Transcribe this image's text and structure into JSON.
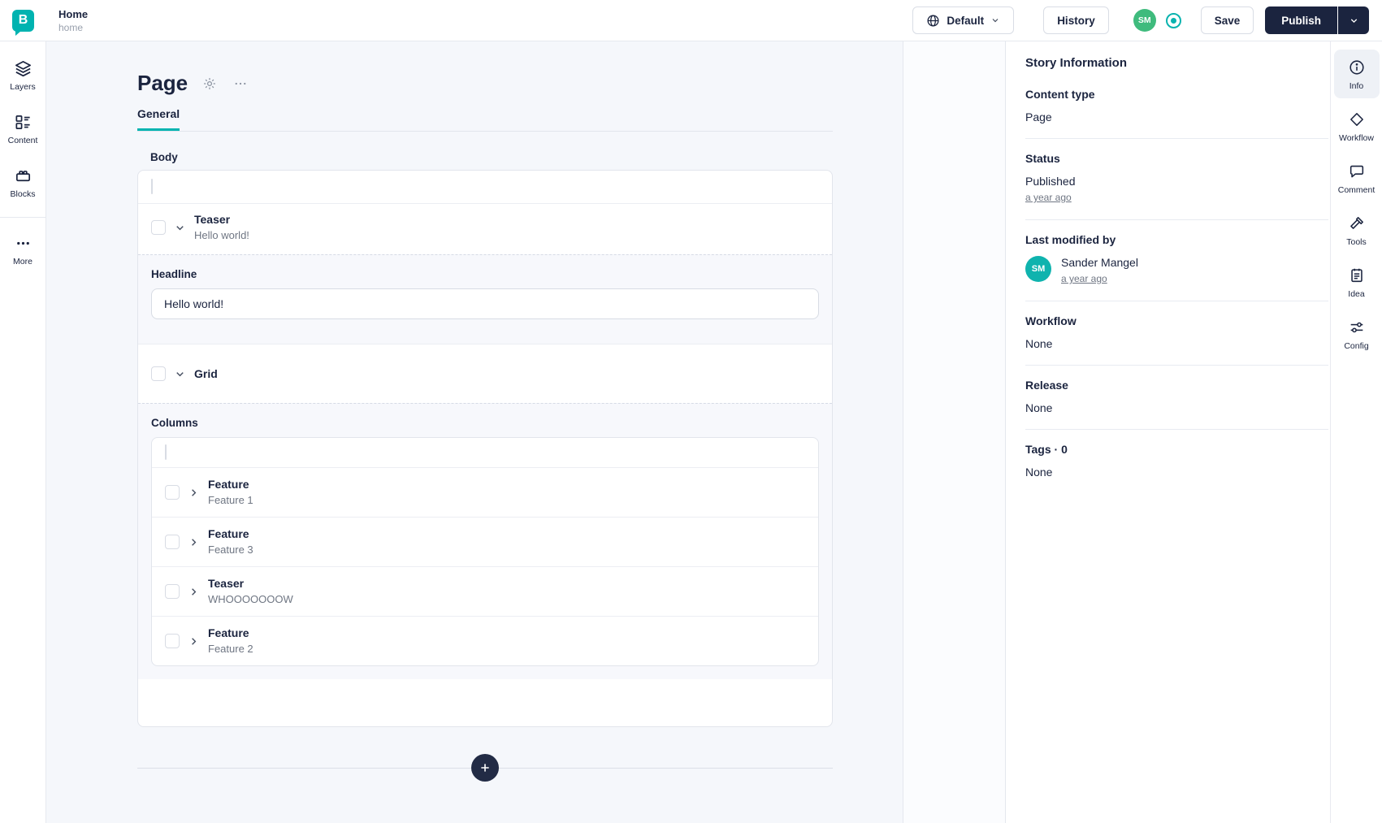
{
  "topbar": {
    "story_title": "Home",
    "story_slug": "home",
    "language_button": "Default",
    "history_button": "History",
    "avatar_initials": "SM",
    "save_button": "Save",
    "publish_button": "Publish"
  },
  "left_rail": {
    "items": [
      {
        "label": "Layers"
      },
      {
        "label": "Content"
      },
      {
        "label": "Blocks"
      },
      {
        "label": "More"
      }
    ]
  },
  "editor": {
    "title": "Page",
    "tab_general": "General",
    "body_field_label": "Body",
    "teaser_block": {
      "title": "Teaser",
      "subtitle": "Hello world!"
    },
    "headline_field": {
      "label": "Headline",
      "value": "Hello world!"
    },
    "grid_block": {
      "title": "Grid"
    },
    "columns_field_label": "Columns",
    "column_blocks": [
      {
        "title": "Feature",
        "subtitle": "Feature 1"
      },
      {
        "title": "Feature",
        "subtitle": "Feature 3"
      },
      {
        "title": "Teaser",
        "subtitle": "WHOOOOOOOW"
      },
      {
        "title": "Feature",
        "subtitle": "Feature 2"
      }
    ]
  },
  "story_info": {
    "title": "Story Information",
    "sections": [
      {
        "label": "Content type",
        "value": "Page"
      },
      {
        "label": "Status",
        "value": "Published",
        "link": "a year ago"
      },
      {
        "label": "Last modified by",
        "value": "Sander Mangel",
        "link": "a year ago",
        "avatar_initials": "SM"
      },
      {
        "label": "Workflow",
        "value": "None"
      },
      {
        "label": "Release",
        "value": "None"
      },
      {
        "label": "Tags · 0",
        "value": "None"
      }
    ]
  },
  "right_rail": {
    "items": [
      {
        "label": "Info"
      },
      {
        "label": "Workflow"
      },
      {
        "label": "Comment"
      },
      {
        "label": "Tools"
      },
      {
        "label": "Idea"
      },
      {
        "label": "Config"
      }
    ]
  },
  "colors": {
    "brand_teal": "#00b3b0",
    "navy": "#1b243f",
    "avatar_green": "#3fbb7d",
    "panel_background": "#f5f7fb"
  }
}
